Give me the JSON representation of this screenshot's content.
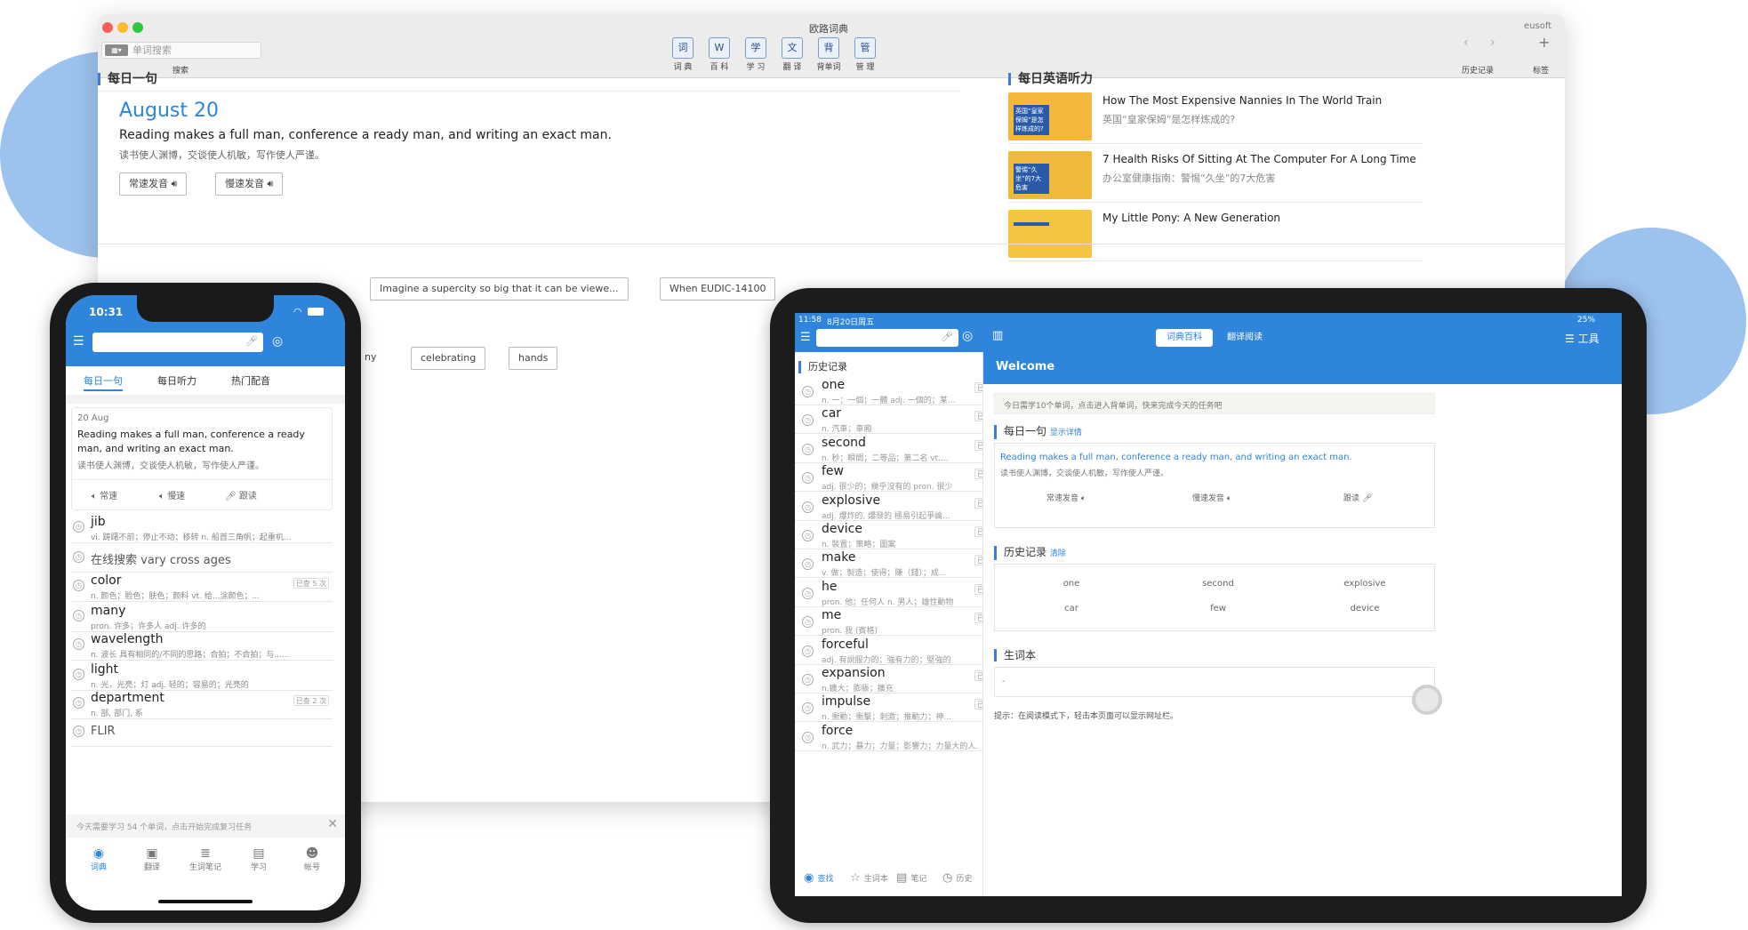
{
  "mac": {
    "window_title": "欧路词典",
    "brand": "eusoft",
    "search_placeholder": "单词搜索",
    "search_label": "搜索",
    "toolbar": [
      {
        "label": "词 典",
        "icon": "dictionary-icon",
        "glyph": "词"
      },
      {
        "label": "百 科",
        "icon": "wikipedia-icon",
        "glyph": "W"
      },
      {
        "label": "学 习",
        "icon": "study-icon",
        "glyph": "学"
      },
      {
        "label": "翻 译",
        "icon": "translate-icon",
        "glyph": "文"
      },
      {
        "label": "背单词",
        "icon": "flashcard-icon",
        "glyph": "背"
      },
      {
        "label": "管 理",
        "icon": "manage-icon",
        "glyph": "管"
      }
    ],
    "history_label": "历史记录",
    "tag_label": "标签",
    "daily": {
      "section": "每日一句",
      "date": "August 20",
      "sentence": "Reading makes a full man, conference a ready man, and writing an exact man.",
      "translation": "读书使人渊博，交谈使人机敏，写作使人严谨。",
      "normal_btn": "常速发音",
      "slow_btn": "慢速发音"
    },
    "listening": {
      "section": "每日英语听力",
      "items": [
        {
          "title": "How The Most Expensive Nannies In The World Train",
          "subtitle": "英国“皇家保姆”是怎样炼成的?",
          "thumb_text": "英国“皇家保姆”是怎样炼成的?"
        },
        {
          "title": "7 Health Risks Of Sitting At The Computer For A Long Time",
          "subtitle": "办公室健康指南：警惕“久坐”的7大危害",
          "thumb_text": "警惕“久坐”的7大危害"
        },
        {
          "title": "My Little Pony: A New Generation",
          "subtitle": "",
          "thumb_text": ""
        }
      ]
    },
    "pills_row1": [
      "Imagine a supercity so big that it can be viewe...",
      "When EUDIC-14100"
    ],
    "pills_row2": [
      "ny",
      "celebrating",
      "hands"
    ]
  },
  "phone": {
    "time": "10:31",
    "tabs": [
      "每日一句",
      "每日听力",
      "热门配音"
    ],
    "card": {
      "date": "20 Aug",
      "sentence": "Reading makes a full man, conference a ready man, and writing an exact man.",
      "translation": "读书使人渊博，交谈使人机敏，写作使人严谨。",
      "actions": [
        "常速",
        "慢速",
        "跟读"
      ]
    },
    "words": [
      {
        "w": "jib",
        "d": "vi. 踌躇不前；停止不动；移转 n. 船首三角帆；起重机...",
        "b": ""
      },
      {
        "w": "在线搜索 vary cross ages",
        "d": "",
        "b": ""
      },
      {
        "w": "color",
        "d": "n. 颜色；脸色；肤色；颜料 vt. 给...涂颜色；...",
        "b": "已查 5 次"
      },
      {
        "w": "many",
        "d": "pron. 许多；许多人 adj. 许多的",
        "b": ""
      },
      {
        "w": "wavelength",
        "d": "n. 波长 具有相同的/不同的思路；合拍；不合拍；与......",
        "b": ""
      },
      {
        "w": "light",
        "d": "n. 光，光亮；灯 adj. 轻的；容易的；光亮的",
        "b": ""
      },
      {
        "w": "department",
        "d": "n. 部, 部门, 系",
        "b": "已查 2 次"
      },
      {
        "w": "FLIR",
        "d": "",
        "b": ""
      }
    ],
    "notice": "今天需要学习 54 个单词，点击开始完成复习任务",
    "bottom_tabs": [
      {
        "label": "词典",
        "icon": "search-icon"
      },
      {
        "label": "翻译",
        "icon": "translate-icon"
      },
      {
        "label": "生词笔记",
        "icon": "notebook-icon"
      },
      {
        "label": "学习",
        "icon": "book-icon"
      },
      {
        "label": "帐号",
        "icon": "user-icon"
      }
    ]
  },
  "tablet": {
    "status_time": "11:58",
    "status_date": "8月20日周五",
    "battery": "25%",
    "seg": [
      "词典百科",
      "翻译阅读"
    ],
    "tools": "工具",
    "history_head": "历史记录",
    "words": [
      {
        "w": "one",
        "d": "n. 一；一個；一體 adj. 一個的；某...",
        "b": "已查 2 次"
      },
      {
        "w": "car",
        "d": "n. 汽車；車廂",
        "b": "已查 3 次"
      },
      {
        "w": "second",
        "d": "n. 秒；瞬間；二等品；第二名 vt....",
        "b": "已查 3 次"
      },
      {
        "w": "few",
        "d": "adj. 很少的；幾乎沒有的 pron. 很少",
        "b": "已查 3 次"
      },
      {
        "w": "explosive",
        "d": "adj. 爆炸的, 爆發的 極易引起爭論...",
        "b": "已查 3 次"
      },
      {
        "w": "device",
        "d": "n. 裝置；策略；圖案",
        "b": "已查 3 次"
      },
      {
        "w": "make",
        "d": "v. 做；製造；使得；賺（錢）；成...",
        "b": "已查 3 次"
      },
      {
        "w": "he",
        "d": "pron. 他；任何人 n. 男人；雄性動物",
        "b": "已查 3 次"
      },
      {
        "w": "me",
        "d": "pron. 我 (賓格)",
        "b": "已查 3 次"
      },
      {
        "w": "forceful",
        "d": "adj. 有說服力的；強有力的；堅強的",
        "b": ""
      },
      {
        "w": "expansion",
        "d": "n.擴大；膨脹；擴充",
        "b": "已查 4 次"
      },
      {
        "w": "impulse",
        "d": "n. 衝動；衝擊；刺激；推動力；神...",
        "b": "已查 3 次"
      },
      {
        "w": "force",
        "d": "n. 武力；暴力；力量；影響力；力量大的人...",
        "b": ""
      }
    ],
    "bottom": [
      "查找",
      "生词本",
      "笔记",
      "历史"
    ],
    "welcome": "Welcome",
    "notice": "今日需学10个单词，点击进入背单词，快来完成今天的任务吧",
    "daily_head": "每日一句",
    "daily_link": "显示详情",
    "sentence": "Reading makes a full man, conference a ready man, and writing an exact man.",
    "translation": "读书使人渊博，交谈使人机敏，写作使人严谨。",
    "actions": [
      "常速发音",
      "慢速发音",
      "跟读"
    ],
    "hist_head": "历史记录",
    "hist_link": "清除",
    "hist_words": [
      "one",
      "second",
      "explosive",
      "car",
      "few",
      "device"
    ],
    "vocab_head": "生词本",
    "vocab_value": "-",
    "tip": "提示：在阅读模式下，轻击本页面可以显示网址栏。"
  },
  "colors": {
    "accent": "#2f84dc",
    "blob": "#9cc2ee"
  }
}
